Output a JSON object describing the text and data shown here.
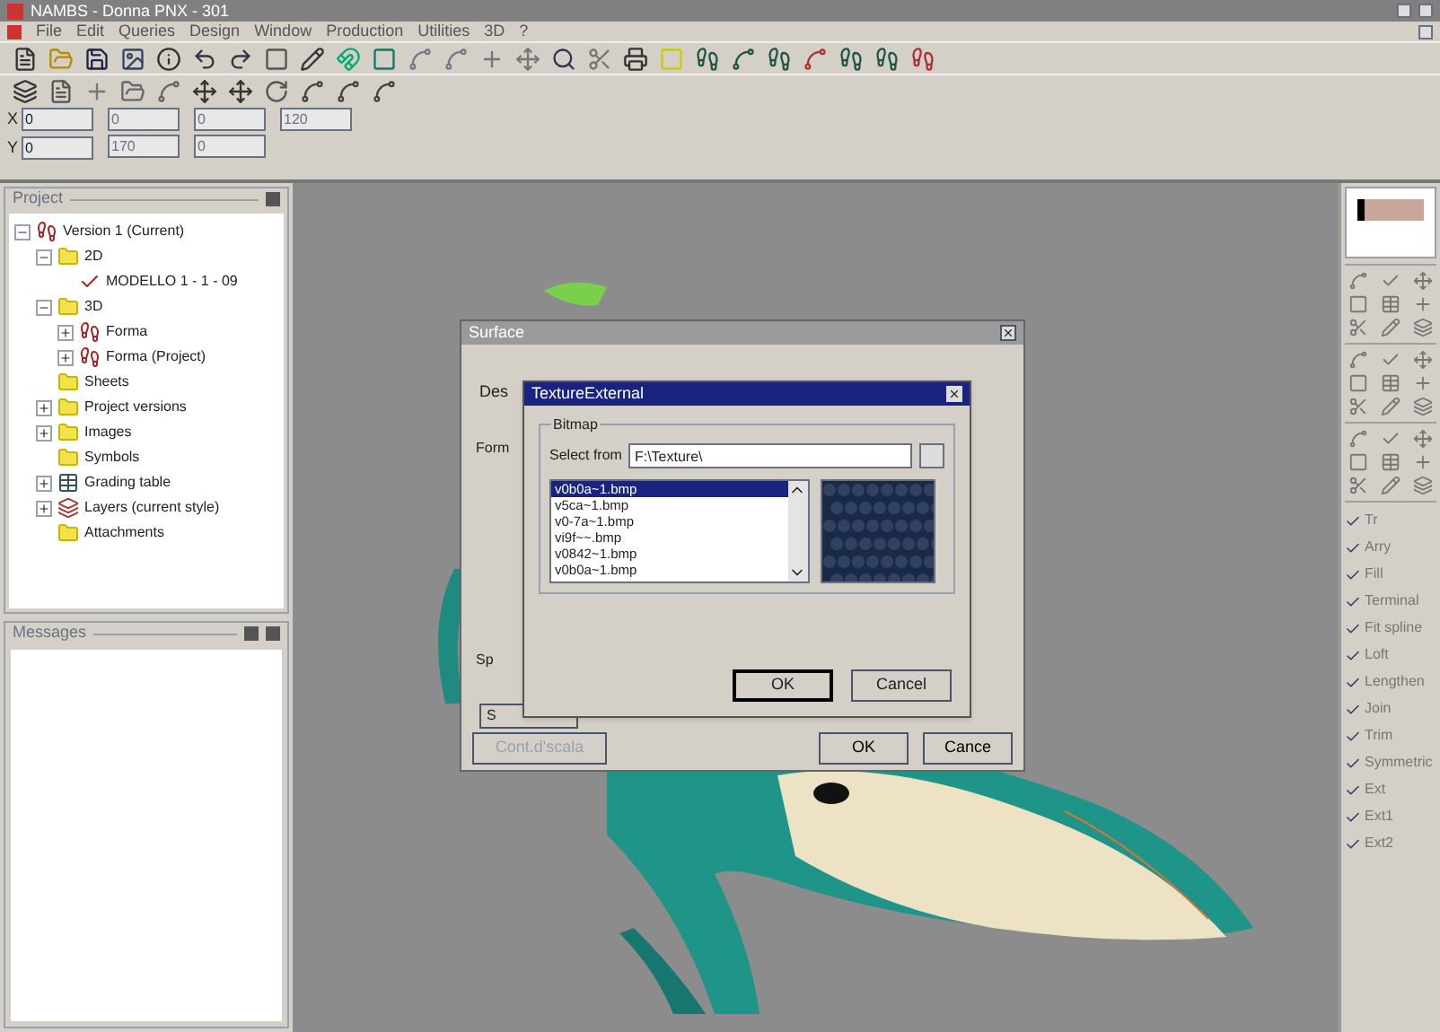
{
  "window": {
    "title": "NAMBS - Donna PNX - 301"
  },
  "menu": [
    "File",
    "Edit",
    "Queries",
    "Design",
    "Window",
    "Production",
    "Utilities",
    "3D",
    "?"
  ],
  "coords": [
    {
      "label": "X",
      "value": "0"
    },
    {
      "label": "Y",
      "value": "0"
    }
  ],
  "coord_fields": [
    "0",
    "0",
    "120",
    "170",
    "0"
  ],
  "project": {
    "title": "Project",
    "tree": [
      {
        "label": "Version 1 (Current)",
        "kind": "shoe",
        "expanded": true,
        "children": [
          {
            "label": "2D",
            "kind": "folder",
            "expanded": true,
            "children": [
              {
                "label": "MODELLO 1 - 1 - 09",
                "kind": "check"
              }
            ]
          },
          {
            "label": "3D",
            "kind": "folder",
            "expanded": true,
            "children": [
              {
                "label": "Forma",
                "kind": "shoe",
                "expanded": false
              },
              {
                "label": "Forma (Project)",
                "kind": "shoe",
                "expanded": false
              }
            ]
          },
          {
            "label": "Sheets",
            "kind": "folder"
          },
          {
            "label": "Project versions",
            "kind": "folder",
            "expanded": false
          },
          {
            "label": "Images",
            "kind": "folder",
            "expanded": false
          },
          {
            "label": "Symbols",
            "kind": "folder"
          },
          {
            "label": "Grading table",
            "kind": "table",
            "expanded": false
          },
          {
            "label": "Layers (current style)",
            "kind": "layers",
            "expanded": false
          },
          {
            "label": "Attachments",
            "kind": "folder"
          }
        ]
      }
    ]
  },
  "messages": {
    "title": "Messages"
  },
  "surface_dialog": {
    "title": "Surface",
    "label_1": "Des",
    "label_2": "Form",
    "label_3": "Sp",
    "button_partial": "S",
    "buttons": [
      {
        "label": "Cont.d'scala",
        "disabled": true
      },
      {
        "label": "OK",
        "disabled": false
      },
      {
        "label": "Cance",
        "disabled": false
      }
    ]
  },
  "texture_dialog": {
    "title": "TextureExternal",
    "group": "Bitmap",
    "select_label": "Select from",
    "path": "F:\\Texture\\",
    "files": [
      {
        "name": "v0b0a~1.bmp",
        "selected": true
      },
      {
        "name": "v5ca~1.bmp",
        "selected": false
      },
      {
        "name": "v0-7a~1.bmp",
        "selected": false
      },
      {
        "name": "vi9f~~.bmp",
        "selected": false
      },
      {
        "name": "v0842~1.bmp",
        "selected": false
      },
      {
        "name": "v0b0a~1.bmp",
        "selected": false
      }
    ],
    "buttons": [
      "OK",
      "Cancel"
    ]
  },
  "right_panel": {
    "commands": [
      "Tr",
      "Arry",
      "Fill",
      "Terminal",
      "Fit spline",
      "Loft",
      "Lengthen",
      "Join",
      "Trim",
      "Symmetric",
      "Ext",
      "Ext1",
      "Ext2"
    ]
  }
}
